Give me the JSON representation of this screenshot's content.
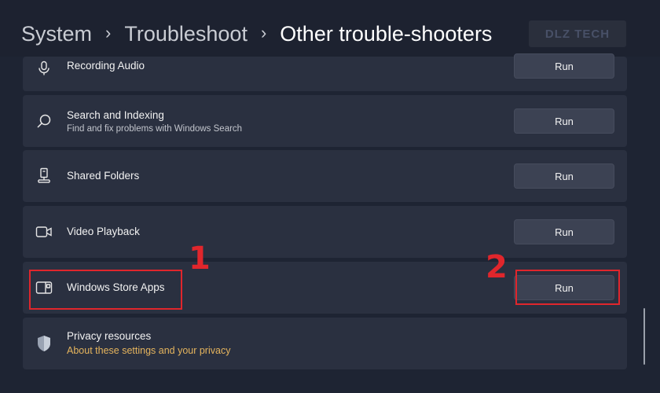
{
  "breadcrumb": {
    "items": [
      "System",
      "Troubleshoot",
      "Other trouble-shooters"
    ],
    "separator": "›"
  },
  "watermark": {
    "text": "DLZ TECH"
  },
  "rows": [
    {
      "icon": "microphone-icon",
      "title": "Recording Audio",
      "button": "Run"
    },
    {
      "icon": "search-icon",
      "title": "Search and Indexing",
      "description": "Find and fix problems with Windows Search",
      "button": "Run"
    },
    {
      "icon": "shared-folder-icon",
      "title": "Shared Folders",
      "button": "Run"
    },
    {
      "icon": "video-camera-icon",
      "title": "Video Playback",
      "button": "Run"
    },
    {
      "icon": "store-app-icon",
      "title": "Windows Store Apps",
      "button": "Run"
    },
    {
      "icon": "shield-icon",
      "title": "Privacy resources",
      "link": "About these settings and your privacy"
    }
  ],
  "annotations": {
    "marker_1": "1",
    "marker_2": "2"
  },
  "colors": {
    "background": "#1e2433",
    "card": "#2a3040",
    "button": "#3c4253",
    "link": "#e5b45d",
    "highlight": "#e0262c"
  }
}
